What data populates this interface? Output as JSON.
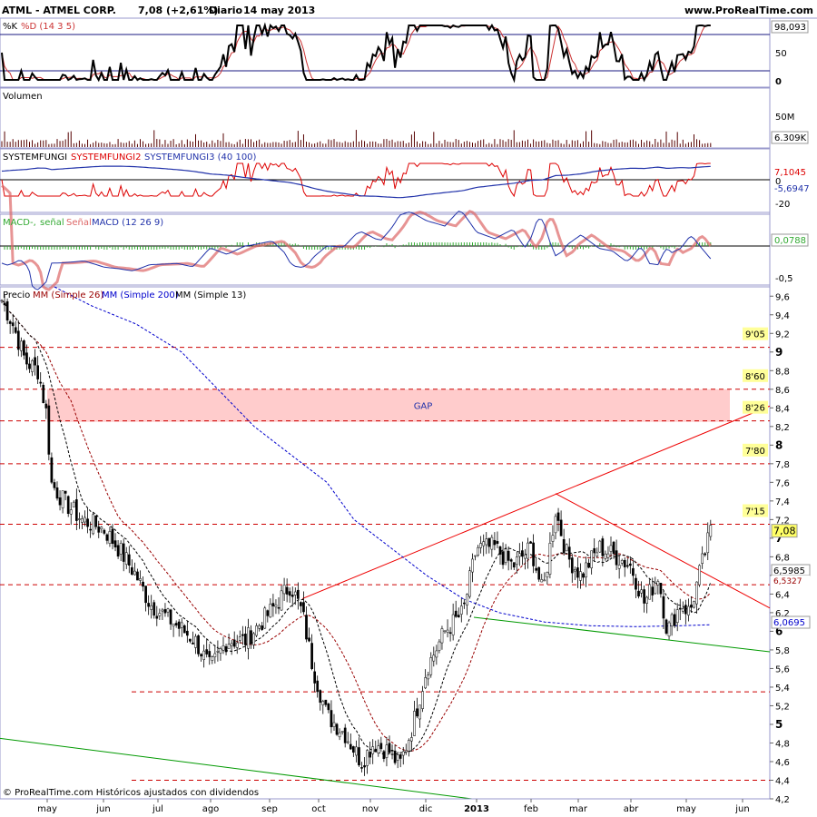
{
  "header": {
    "ticker": "ATML - ATMEL CORP.",
    "price_change": "7,08 (+2,61%)",
    "period": "Diario",
    "date": "14 may 2013",
    "site": "www.ProRealTime.com"
  },
  "footer": {
    "copyright": "© ProRealTime.com Históricos ajustados con dividendos"
  },
  "colors": {
    "background": "#ffffff",
    "grid_border": "#9999cc",
    "up_candle": "#ffffff",
    "down_candle": "#000000",
    "stoch_k": "#000000",
    "stoch_d": "#cc3333",
    "sysf2": "#dd0000",
    "sysf3": "#2233aa",
    "macd_hist": "#33aa33",
    "macd_signal": "#dd6666",
    "ma26": "#990000",
    "ma200": "#0000cc",
    "ma13": "#000000",
    "trend_red": "#ee0000",
    "trend_green": "#009900",
    "gap_fill": "#ffcccc",
    "label_bg": "#ffff99"
  },
  "x_axis_months": [
    "may",
    "jun",
    "jul",
    "ago",
    "sep",
    "oct",
    "nov",
    "dic",
    "2013",
    "feb",
    "mar",
    "abr",
    "may",
    "jun"
  ],
  "stochastic": {
    "title_k": "%K",
    "title_d": "%D (14 3 5)",
    "value_box": "98,093",
    "ticks": [
      "50",
      "0"
    ],
    "levels": [
      80,
      20
    ]
  },
  "volume": {
    "title": "Volumen",
    "ticks": [
      "50M"
    ],
    "value_box": "6.309K"
  },
  "systemfungi": {
    "title_1": "SYSTEMFUNGI",
    "title_2": "SYSTEMFUNGI2",
    "title_3": "SYSTEMFUNGI3 (40 100)",
    "value_box_red": "7,1045",
    "value_zero": "0",
    "value_box_blue": "-5,6947",
    "tick": "-20"
  },
  "macd": {
    "title_1": "MACD-,",
    "title_2": "señal",
    "title_3": "Señal",
    "title_4": "MACD (12 26 9)",
    "value_box": "0,0788",
    "tick": "-0,5"
  },
  "price": {
    "title_1": "Precio",
    "title_2": "MM (Simple 26)",
    "title_3": "MM (Simple 200)",
    "title_4": "MM (Simple 13)",
    "ticks": [
      "9,6",
      "9,4",
      "9,2",
      "9",
      "8,8",
      "8,6",
      "8,4",
      "8,2",
      "8",
      "7,8",
      "7,6",
      "7,4",
      "7,2",
      "7",
      "6,8",
      "6,6",
      "6,4",
      "6,2",
      "6",
      "5,8",
      "5,6",
      "5,4",
      "5,2",
      "5",
      "4,8",
      "4,6",
      "4,4",
      "4,2"
    ],
    "ylim": [
      4.2,
      9.7
    ],
    "last_price_box": "7,08",
    "ma_box_1": "6,5985",
    "ma_box_2": "6,5327",
    "ma200_box": "6,0695",
    "gap_label": "GAP",
    "gap_range": [
      8.25,
      8.6
    ],
    "levels": [
      {
        "value": 9.05,
        "label": "9'05"
      },
      {
        "value": 8.6,
        "label": "8'60"
      },
      {
        "value": 8.26,
        "label": "8'26"
      },
      {
        "value": 7.8,
        "label": "7'80"
      },
      {
        "value": 7.15,
        "label": "7'15"
      },
      {
        "value": 6.5,
        "label": ""
      },
      {
        "value": 5.35,
        "label": ""
      },
      {
        "value": 4.4,
        "label": ""
      }
    ]
  },
  "chart_data": {
    "type": "line",
    "title": "ATML - ATMEL CORP.",
    "ylim": [
      4.2,
      9.7
    ],
    "x_months": [
      "may",
      "jun",
      "jul",
      "ago",
      "sep",
      "oct",
      "nov",
      "dic",
      "2013",
      "feb",
      "mar",
      "abr",
      "may",
      "jun"
    ],
    "price_close_monthly": [
      {
        "month": "may",
        "value": 8.8
      },
      {
        "month": "jun",
        "value": 7.3
      },
      {
        "month": "jul",
        "value": 6.4
      },
      {
        "month": "ago",
        "value": 5.7
      },
      {
        "month": "sep",
        "value": 6.6
      },
      {
        "month": "oct",
        "value": 5.1
      },
      {
        "month": "nov",
        "value": 4.6
      },
      {
        "month": "dic",
        "value": 5.5
      },
      {
        "month": "2013",
        "value": 7.0
      },
      {
        "month": "feb",
        "value": 6.9
      },
      {
        "month": "mar",
        "value": 6.7
      },
      {
        "month": "abr",
        "value": 6.4
      },
      {
        "month": "may",
        "value": 7.08
      }
    ],
    "last_price": 7.08,
    "resistance_levels": [
      9.05,
      8.6,
      8.26,
      7.8,
      7.15
    ],
    "support_levels": [
      6.5,
      5.35,
      4.4
    ]
  }
}
